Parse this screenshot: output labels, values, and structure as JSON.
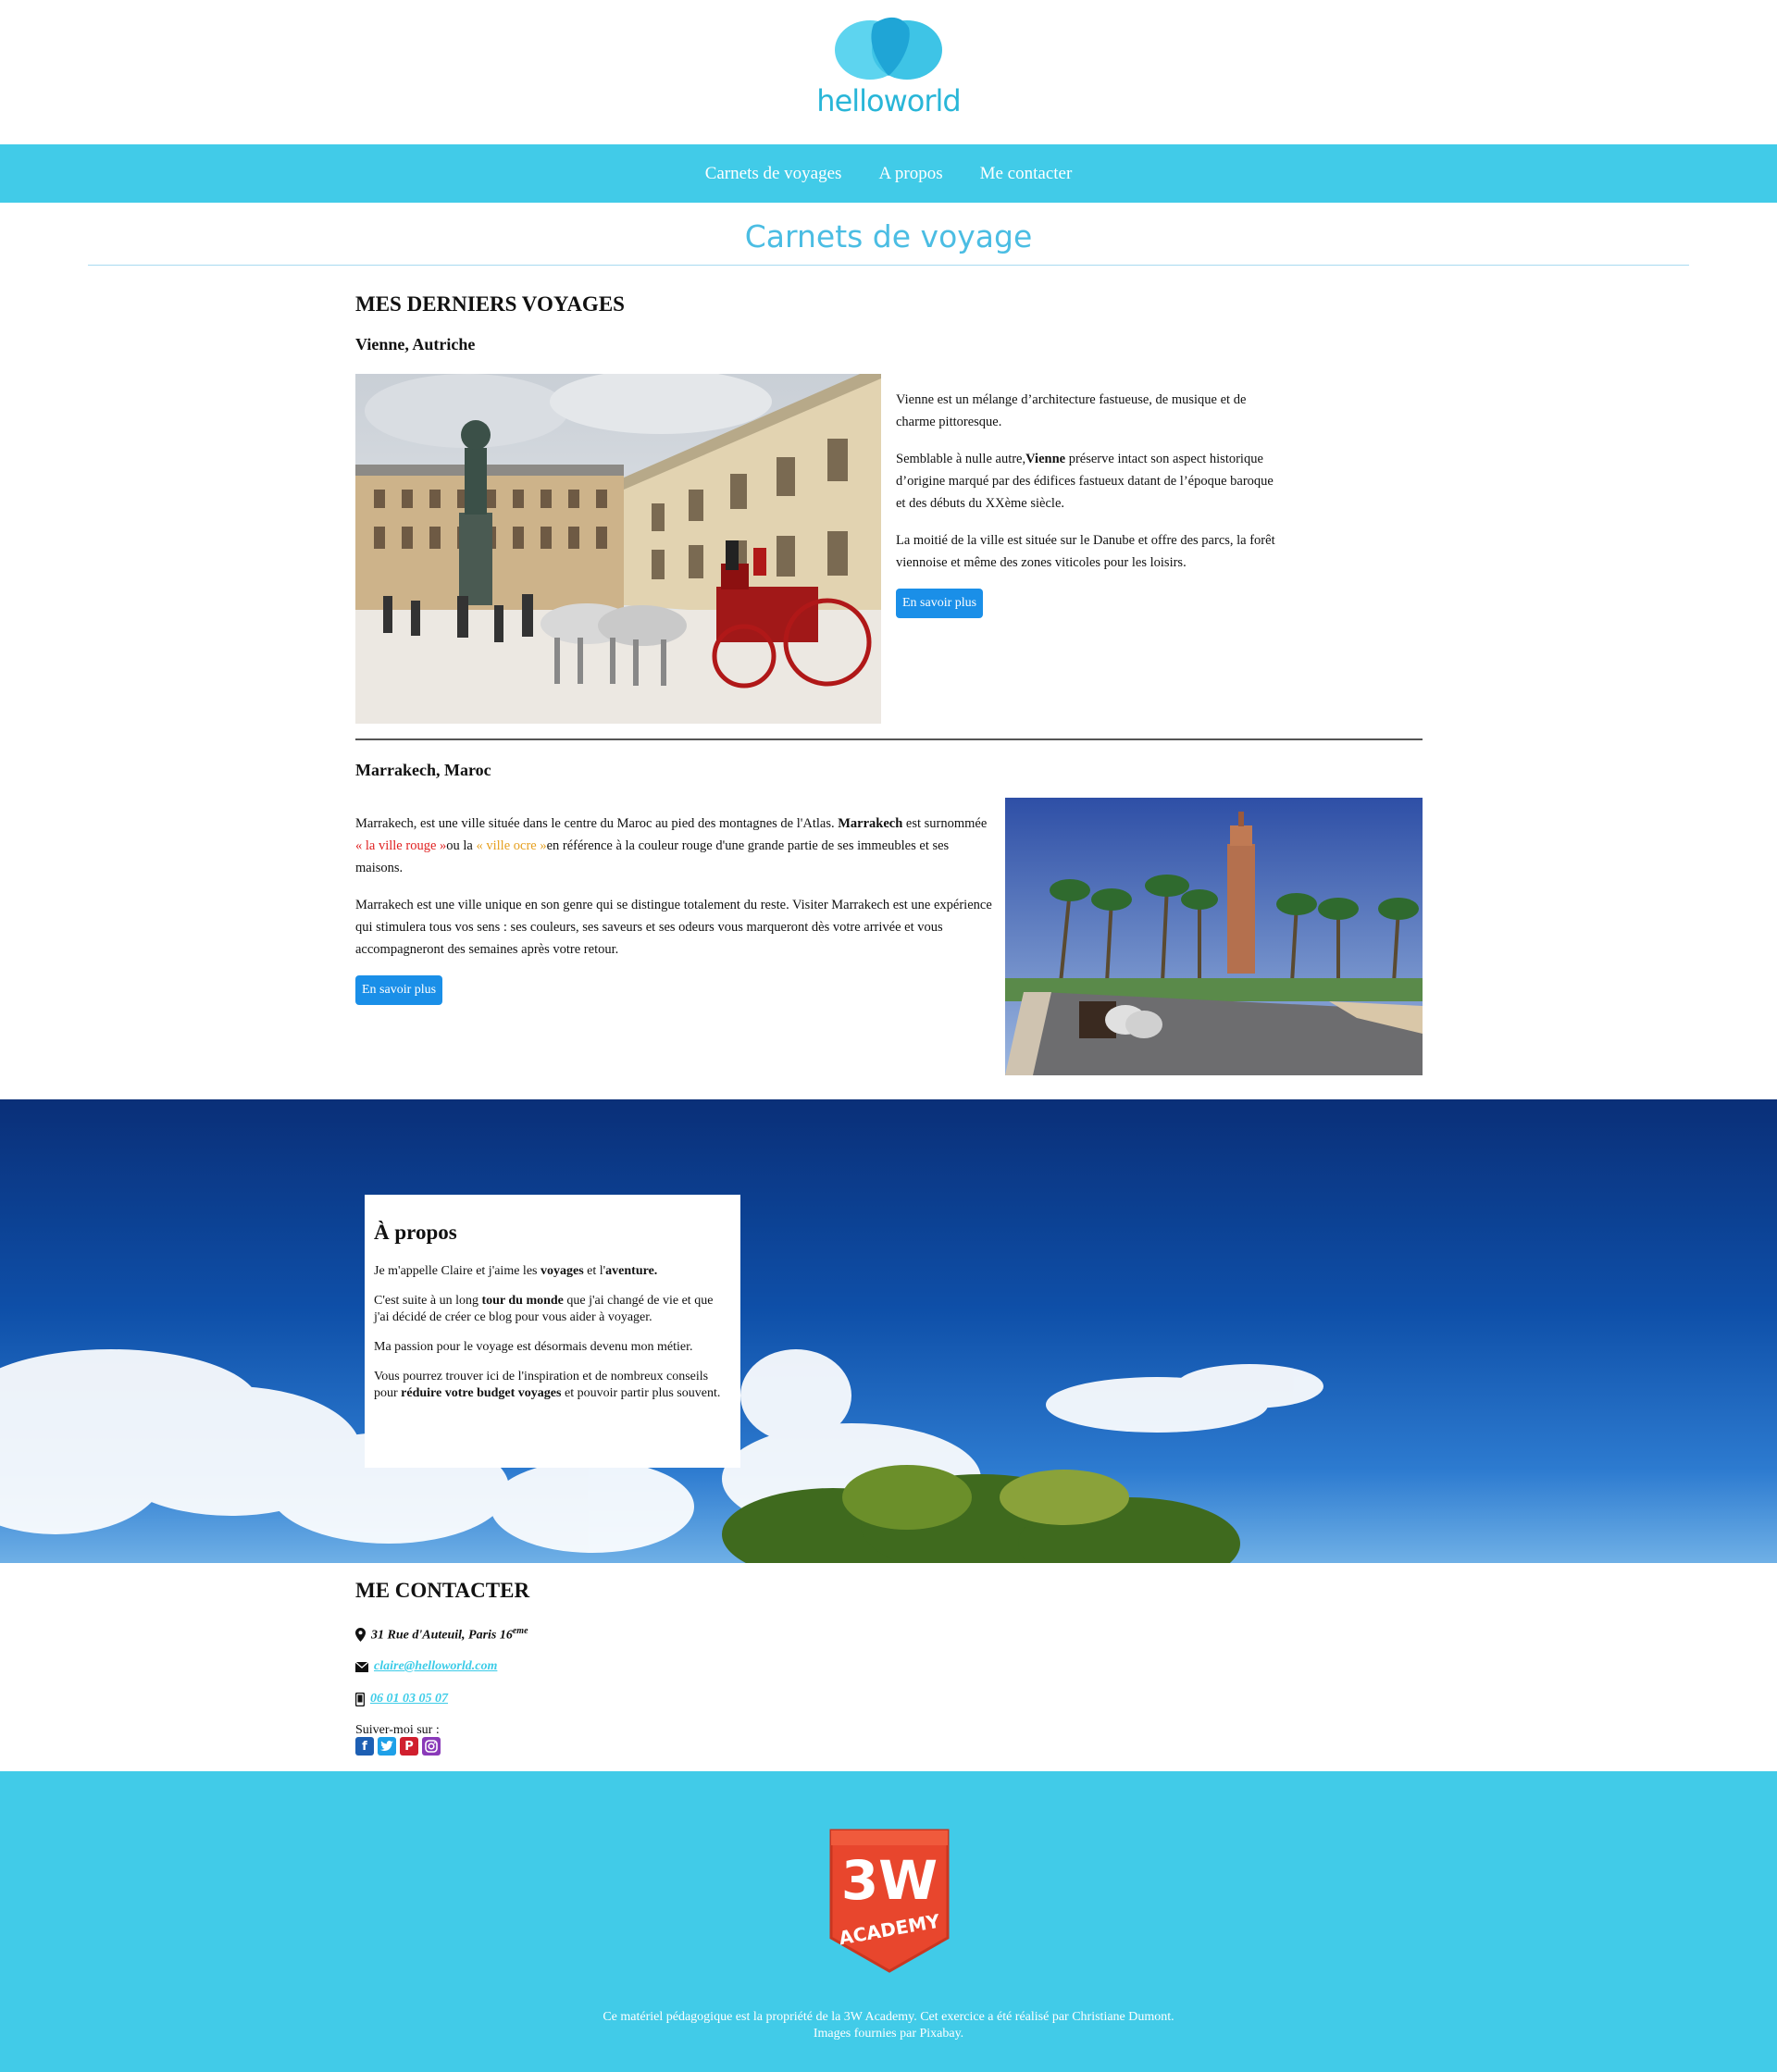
{
  "brand": {
    "logo_text": "helloworld",
    "colors": {
      "primary": "#41cbe8",
      "title": "#4bbde3",
      "button": "#1a8fe8",
      "red_label": "#e02020",
      "ocre_label": "#e6a020"
    }
  },
  "nav": {
    "items": [
      {
        "label": "Carnets de voyages"
      },
      {
        "label": "A propos"
      },
      {
        "label": "Me contacter"
      }
    ]
  },
  "page_title": "Carnets de voyage",
  "voyages": {
    "heading": "MES DERNIERS VOYAGES",
    "vienne": {
      "title": "Vienne, Autriche",
      "p1": "Vienne est un mélange d’architecture fastueuse, de musique et de charme pittoresque.",
      "p2_before": "Semblable à nulle autre,",
      "p2_bold": "Vienne",
      "p2_after": " préserve intact son aspect historique d’origine marqué par des édifices fastueux datant de l’époque baroque et des débuts du XXème siècle.",
      "p3": "La moitié de la ville est située sur le Danube et offre des parcs, la forêt viennoise et même des zones viticoles pour les loisirs.",
      "button": "En savoir plus"
    },
    "marrakech": {
      "title": "Marrakech, Maroc",
      "p1_a": "Marrakech, est une ville située dans le centre du Maroc au pied des montagnes de l'Atlas. ",
      "p1_bold": "Marrakech",
      "p1_b": " est surnommée ",
      "p1_red": "« la ville rouge »",
      "p1_c": "ou la ",
      "p1_ocre": "« ville ocre »",
      "p1_d": "en référence à la couleur rouge d'une grande partie de ses immeubles et ses maisons.",
      "p2": "Marrakech est une ville unique en son genre qui se distingue totalement du reste. Visiter Marrakech est une expérience qui stimulera tous vos sens : ses couleurs, ses saveurs et ses odeurs vous marqueront dès votre arrivée et vous accompagneront des semaines après votre retour.",
      "button": "En savoir plus"
    }
  },
  "about": {
    "title": "À propos",
    "p1_a": "Je m'appelle Claire et j'aime les ",
    "p1_bold1": "voyages",
    "p1_b": " et l'",
    "p1_bold2": "aventure.",
    "p2_a": "C'est suite à un long ",
    "p2_bold": "tour du monde",
    "p2_b": " que j'ai changé de vie et que j'ai décidé de créer ce blog pour vous aider à voyager.",
    "p3": "Ma passion pour le voyage est désormais devenu mon métier.",
    "p4_a": "Vous pourrez trouver ici de l'inspiration et de nombreux conseils pour ",
    "p4_bold": "réduire votre budget voyages",
    "p4_b": " et pouvoir partir plus souvent."
  },
  "contact": {
    "heading": "ME CONTACTER",
    "address": "31 Rue d'Auteuil, Paris 16",
    "address_sup": "eme",
    "email": "claire@helloworld.com",
    "phone": "06 01 03 05 07",
    "follow": "Suiver-moi sur :",
    "social_icons": [
      "facebook-icon",
      "twitter-icon",
      "pinterest-icon",
      "instagram-icon"
    ]
  },
  "footer": {
    "logo_line1": "3W",
    "logo_line2": "ACADEMY",
    "line1": "Ce matériel pédagogique est la propriété de la 3W Academy. Cet exercice a été réalisé par Christiane Dumont.",
    "line2": "Images fournies par Pixabay."
  }
}
